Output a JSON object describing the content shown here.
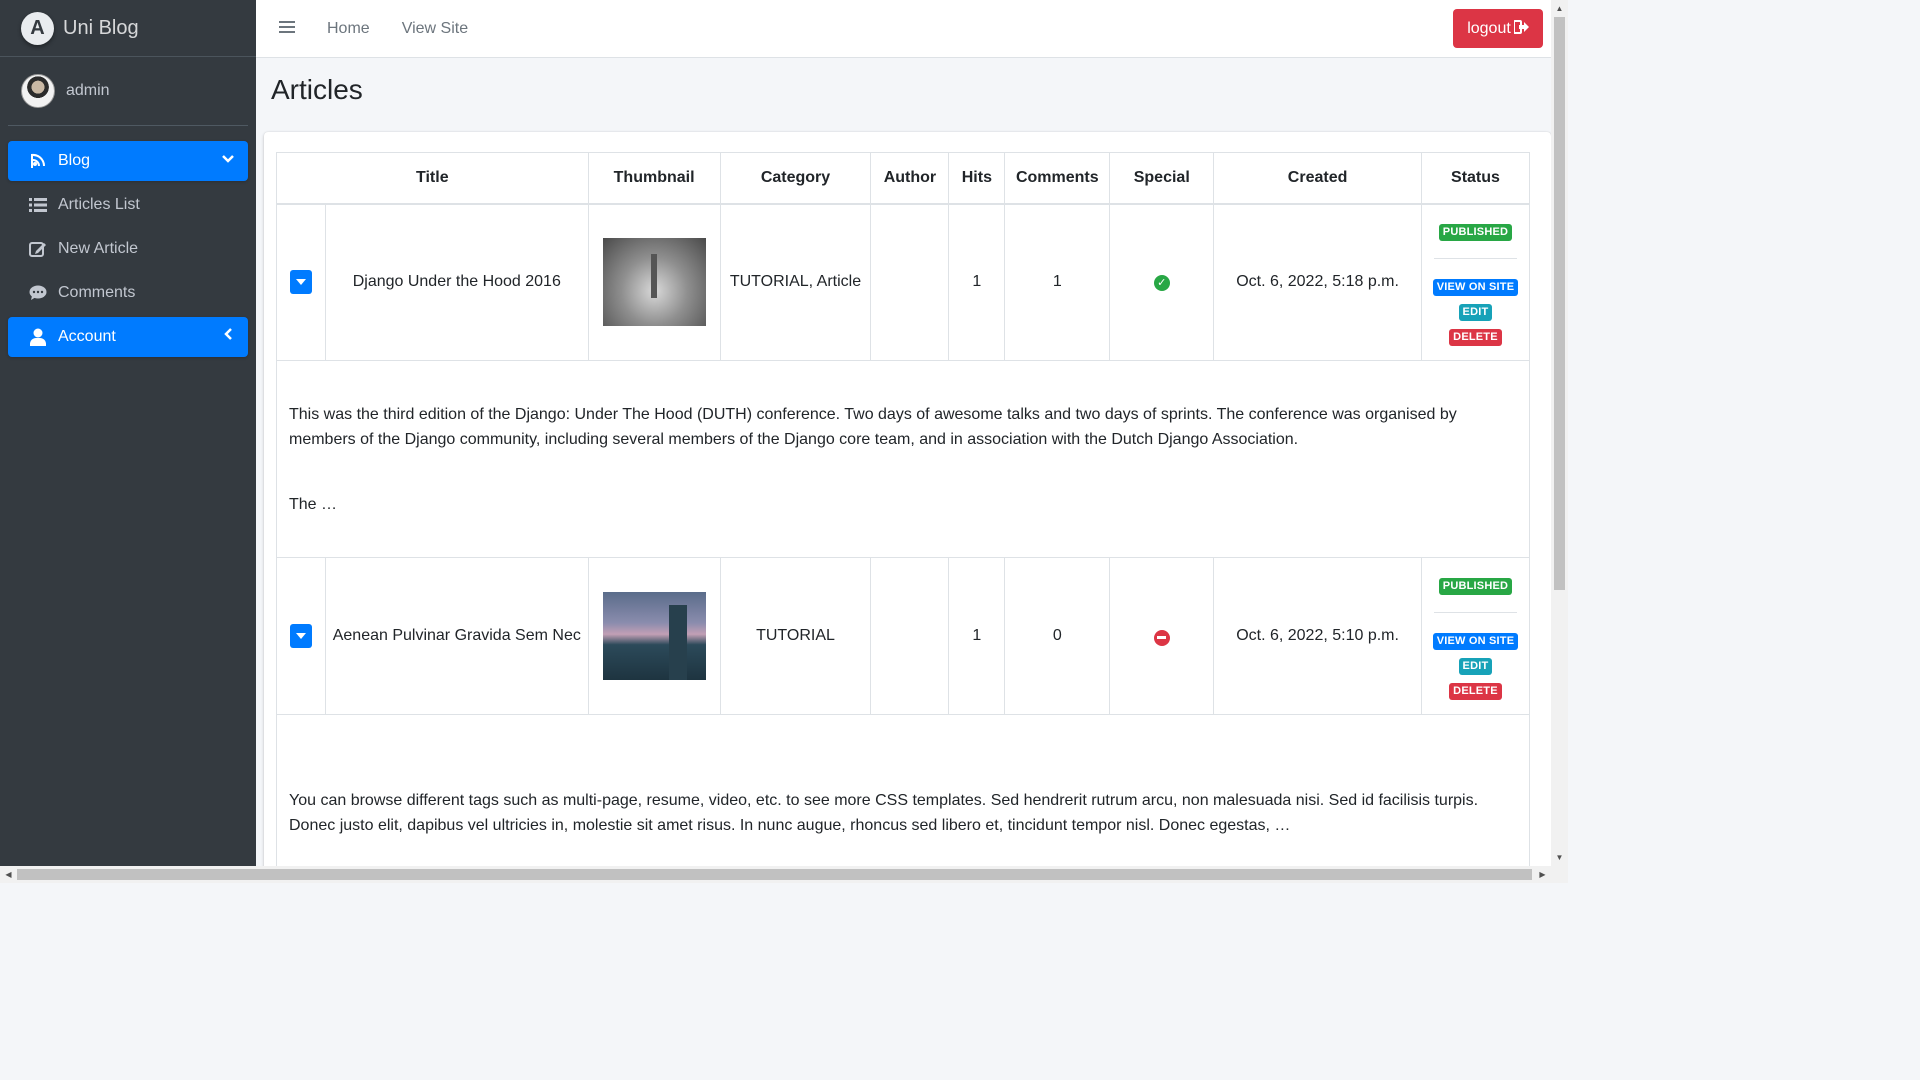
{
  "brand": {
    "name": "Uni Blog",
    "logo_letter": "A"
  },
  "user": {
    "name": "admin"
  },
  "sidebar": {
    "items": [
      {
        "label": "Blog",
        "icon": "blog-icon",
        "active": true,
        "caret": "chevron-down-icon"
      },
      {
        "label": "Articles List",
        "icon": "list-icon",
        "active": false
      },
      {
        "label": "New Article",
        "icon": "edit-icon",
        "active": false
      },
      {
        "label": "Comments",
        "icon": "comment-icon",
        "active": false
      },
      {
        "label": "Account",
        "icon": "user-icon",
        "active": true,
        "caret": "chevron-left-icon"
      }
    ]
  },
  "topbar": {
    "links": [
      "Home",
      "View Site"
    ],
    "logout_label": "logout"
  },
  "page": {
    "title": "Articles"
  },
  "table": {
    "headers": [
      "Title",
      "Thumbnail",
      "Category",
      "Author",
      "Hits",
      "Comments",
      "Special",
      "Created",
      "Status"
    ],
    "rows": [
      {
        "title": "Django Under the Hood 2016",
        "category": "TUTORIAL, Article",
        "author": "",
        "hits": "1",
        "comments": "1",
        "special": true,
        "created": "Oct. 6, 2022, 5:18 p.m.",
        "status": "PUBLISHED",
        "actions": [
          "VIEW ON SITE",
          "EDIT",
          "DELETE"
        ],
        "description": [
          "This was the third edition of the Django: Under The Hood (DUTH) conference. Two days of awesome talks and two days of sprints. The conference was organised by members of the Django community, including several members of the Django core team, and in association with the Dutch Django Association.",
          "The …"
        ]
      },
      {
        "title": "Aenean Pulvinar Gravida Sem Nec",
        "category": "TUTORIAL",
        "author": "",
        "hits": "1",
        "comments": "0",
        "special": false,
        "created": "Oct. 6, 2022, 5:10 p.m.",
        "status": "PUBLISHED",
        "actions": [
          "VIEW ON SITE",
          "EDIT",
          "DELETE"
        ],
        "description": [
          "You can browse different tags such as multi-page, resume, video, etc. to see more CSS templates. Sed hendrerit rutrum arcu, non malesuada nisi. Sed id facilisis turpis. Donec justo elit, dapibus vel ultricies in, molestie sit amet risus. In nunc augue, rhoncus sed libero et, tincidunt tempor nisl. Donec egestas, …"
        ]
      }
    ]
  },
  "colors": {
    "sidebar_bg": "#343a40",
    "primary": "#007bff",
    "danger": "#dc3545",
    "success": "#28a745",
    "info": "#17a2b8"
  }
}
